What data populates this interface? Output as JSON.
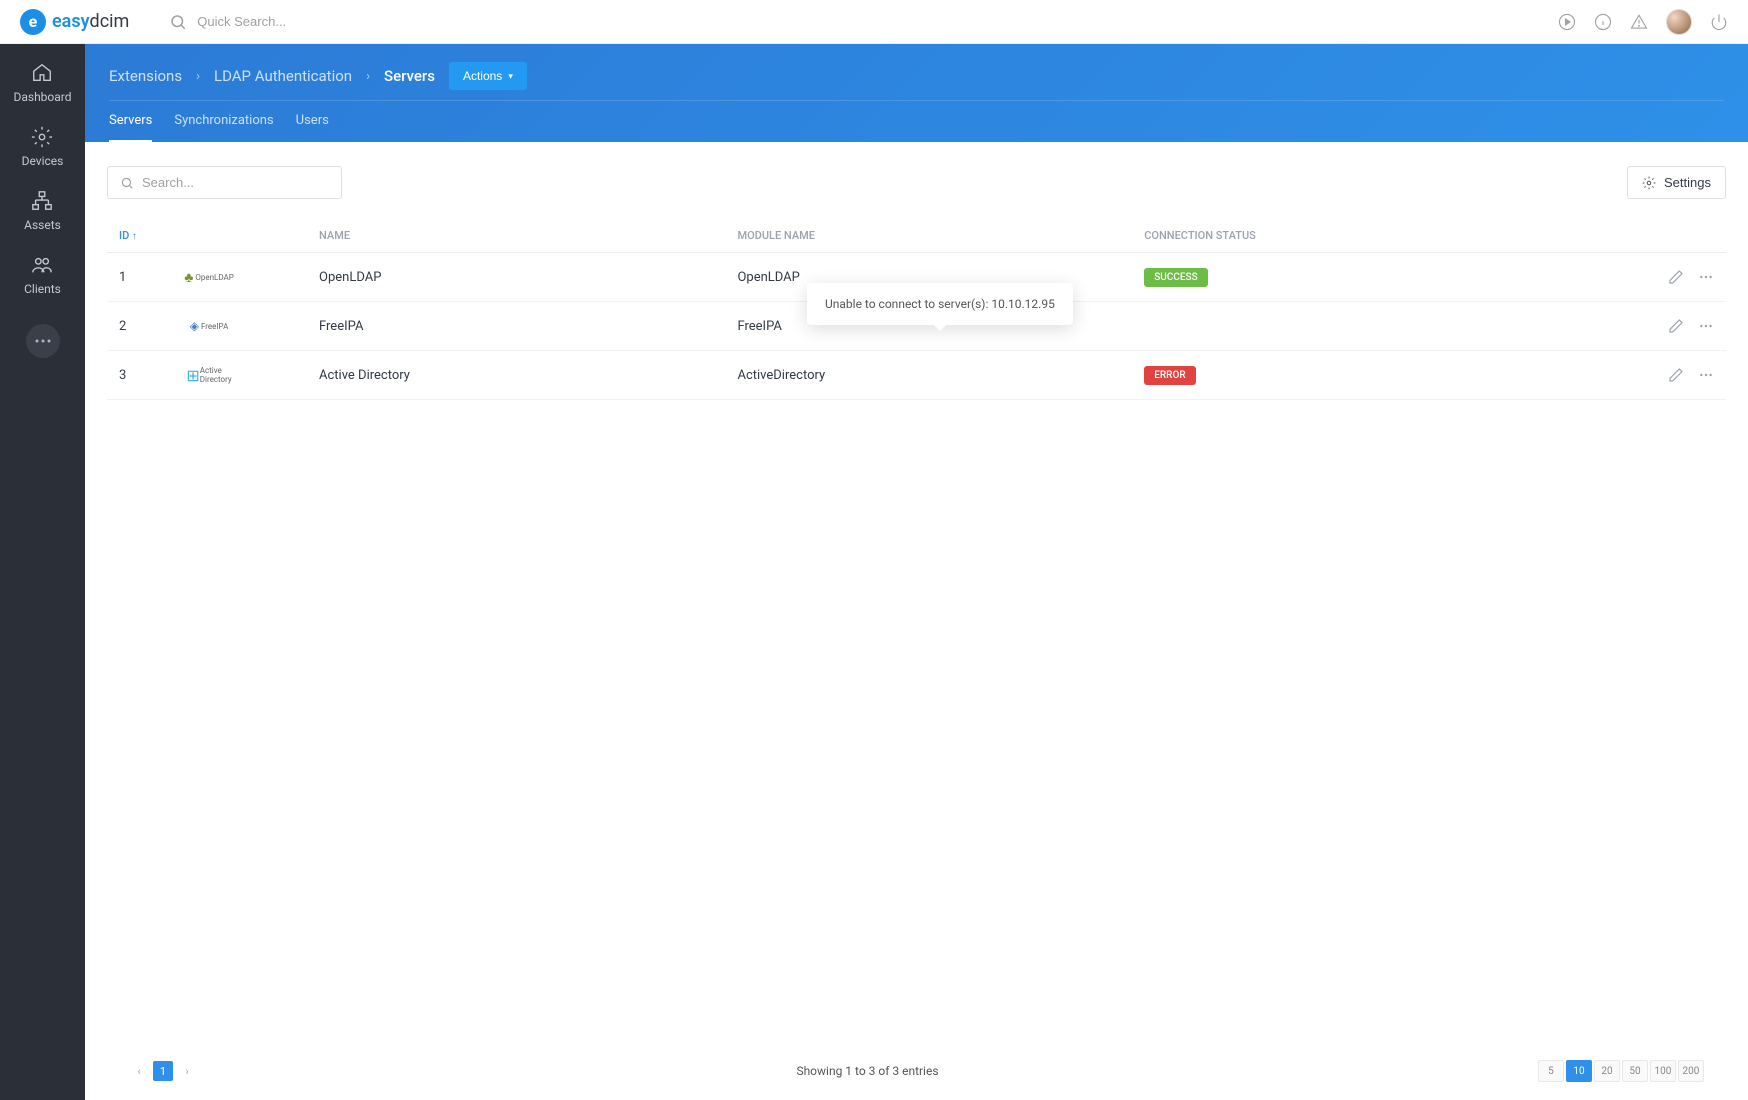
{
  "header": {
    "brand_bold": "easy",
    "brand_rest": "dcim",
    "search_placeholder": "Quick Search..."
  },
  "sidebar": {
    "items": [
      {
        "label": "Dashboard"
      },
      {
        "label": "Devices"
      },
      {
        "label": "Assets"
      },
      {
        "label": "Clients"
      }
    ]
  },
  "breadcrumb": {
    "items": [
      "Extensions",
      "LDAP Authentication",
      "Servers"
    ],
    "actions_label": "Actions"
  },
  "tabs": {
    "items": [
      {
        "label": "Servers",
        "active": true
      },
      {
        "label": "Synchronizations",
        "active": false
      },
      {
        "label": "Users",
        "active": false
      }
    ]
  },
  "controls": {
    "search_placeholder": "Search...",
    "settings_label": "Settings"
  },
  "table": {
    "columns": {
      "id": "ID",
      "name": "NAME",
      "module": "MODULE NAME",
      "connection": "CONNECTION STATUS"
    },
    "rows": [
      {
        "id": "1",
        "name": "OpenLDAP",
        "module": "OpenLDAP",
        "status": "SUCCESS",
        "status_class": "success",
        "vendor": "openldap",
        "vendor_label": "OpenLDAP"
      },
      {
        "id": "2",
        "name": "FreeIPA",
        "module": "FreeIPA",
        "status": "",
        "status_class": "",
        "vendor": "freeipa",
        "vendor_label": "FreeIPA"
      },
      {
        "id": "3",
        "name": "Active Directory",
        "module": "ActiveDirectory",
        "status": "ERROR",
        "status_class": "error",
        "vendor": "ad",
        "vendor_label": "Active Directory"
      }
    ]
  },
  "tooltip": {
    "text": "Unable to connect to server(s): 10.10.12.95"
  },
  "footer": {
    "pages": [
      "1"
    ],
    "active_page": "1",
    "info": "Showing 1 to 3 of 3 entries",
    "page_sizes": [
      "5",
      "10",
      "20",
      "50",
      "100",
      "200"
    ],
    "active_size": "10"
  }
}
